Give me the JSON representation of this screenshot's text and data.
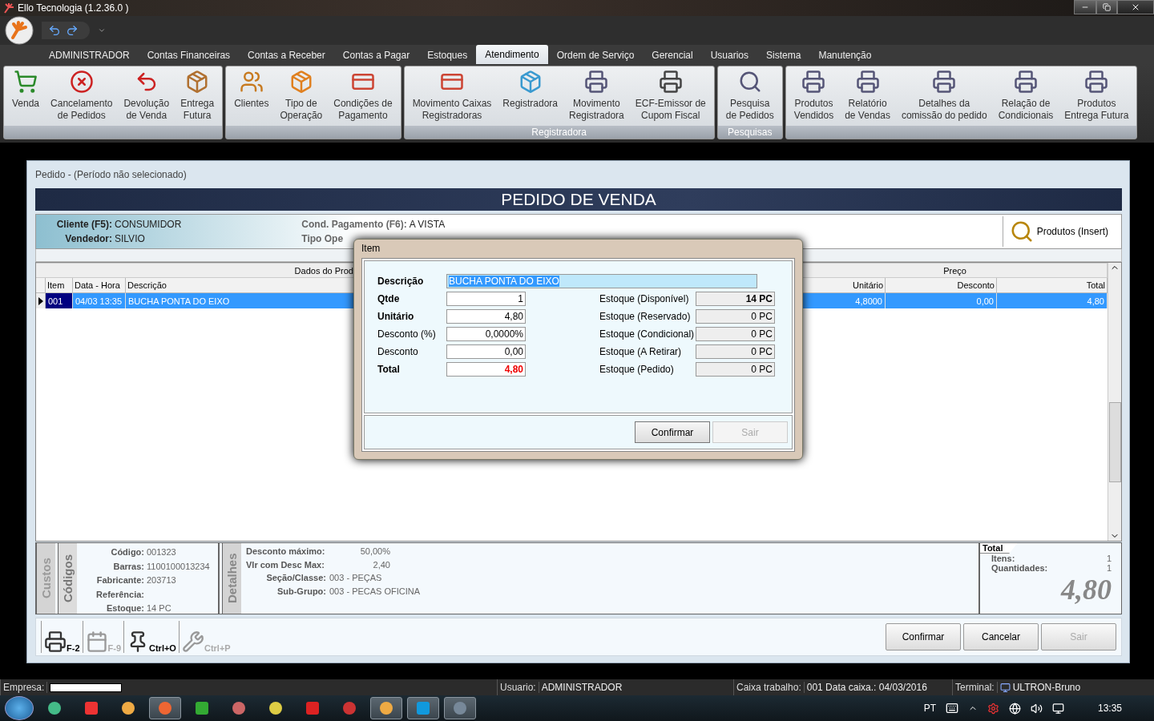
{
  "window": {
    "title": "Ello Tecnologia (1.2.36.0 )"
  },
  "menu_tabs": [
    {
      "label": "ADMINISTRADOR",
      "selected": false
    },
    {
      "label": "Contas Financeiras",
      "selected": false
    },
    {
      "label": "Contas a Receber",
      "selected": false
    },
    {
      "label": "Contas a Pagar",
      "selected": false
    },
    {
      "label": "Estoques",
      "selected": false
    },
    {
      "label": "Atendimento",
      "selected": true
    },
    {
      "label": "Ordem de Serviço",
      "selected": false
    },
    {
      "label": "Gerencial",
      "selected": false
    },
    {
      "label": "Usuarios",
      "selected": false
    },
    {
      "label": "Sistema",
      "selected": false
    },
    {
      "label": "Manutenção",
      "selected": false
    }
  ],
  "ribbon_groups": [
    {
      "items": [
        {
          "lines": [
            "Venda"
          ]
        },
        {
          "lines": [
            "Cancelamento",
            "de Pedidos"
          ]
        },
        {
          "lines": [
            "Devolução",
            "de Venda"
          ]
        },
        {
          "lines": [
            "Entrega",
            "Futura"
          ]
        }
      ]
    },
    {
      "items": [
        {
          "lines": [
            "Clientes"
          ]
        },
        {
          "lines": [
            "Tipo de",
            "Operação"
          ]
        },
        {
          "lines": [
            "Condições de",
            "Pagamento"
          ]
        }
      ]
    },
    {
      "caption": "Registradora",
      "items": [
        {
          "lines": [
            "Movimento Caixas",
            "Registradoras"
          ]
        },
        {
          "lines": [
            "Registradora"
          ]
        },
        {
          "lines": [
            "Movimento",
            "Registradora"
          ]
        },
        {
          "lines": [
            "ECF-Emissor de",
            "Cupom Fiscal"
          ]
        }
      ]
    },
    {
      "caption": "Pesquisas",
      "items": [
        {
          "lines": [
            "Pesquisa",
            "de Pedidos"
          ]
        }
      ]
    },
    {
      "items": [
        {
          "lines": [
            "Produtos",
            "Vendidos"
          ]
        },
        {
          "lines": [
            "Relatório",
            "de Vendas"
          ]
        },
        {
          "lines": [
            "Detalhes da",
            "comissão do pedido"
          ]
        },
        {
          "lines": [
            "Relação de",
            "Condicionais"
          ]
        },
        {
          "lines": [
            "Produtos",
            "Entrega Futura"
          ]
        }
      ]
    }
  ],
  "order_window": {
    "title": "Pedido - (Período não selecionado)",
    "heading": "PEDIDO DE VENDA",
    "info_left": [
      {
        "label": "Cliente (F5):",
        "value": "CONSUMIDOR"
      },
      {
        "label": "Vendedor:",
        "value": "SILVIO"
      }
    ],
    "info_right": [
      {
        "label": "Cond. Pagamento (F6):",
        "value": "A VISTA"
      },
      {
        "label": "Tipo Ope"
      }
    ],
    "products_button": "Produtos (Insert)",
    "grid": {
      "groups": [
        "Dados do Prod",
        "Preço"
      ],
      "columns": [
        "Item",
        "Data - Hora",
        "Descrição",
        "Unitário",
        "Desconto",
        "Total"
      ],
      "rows": [
        {
          "selected": true,
          "cells": [
            "001",
            "04/03 13:35",
            "BUCHA  PONTA DO EIXO",
            "4,8000",
            "0,00",
            "4,80"
          ]
        }
      ]
    },
    "side_tabs": [
      {
        "label": "Custos",
        "selected": false
      },
      {
        "label": "Códigos",
        "selected": true
      }
    ],
    "codes": [
      {
        "label": "Código:",
        "value": "001323"
      },
      {
        "label": "Barras:",
        "value": "1100100013234"
      },
      {
        "label": "Fabricante:",
        "value": "203713"
      },
      {
        "label": "Referência:"
      },
      {
        "label": "Estoque:",
        "value": "14 PC"
      }
    ],
    "details_tab": "Detalhes",
    "details": [
      {
        "label": "Desconto máximo:",
        "value": "50,00%",
        "kind": "pair"
      },
      {
        "label": "Vlr com Desc Max:",
        "value": "2,40",
        "kind": "pair"
      },
      {
        "label": "Seção/Classe:",
        "value": "003 - PEÇAS",
        "kind": "inline"
      },
      {
        "label": "Sub-Grupo:",
        "value": "003 - PECAS OFICINA",
        "kind": "inline"
      }
    ],
    "totals": {
      "title": "Total",
      "rows": [
        {
          "label": "Itens:",
          "value": "1"
        },
        {
          "label": "Quantidades:",
          "value": "1"
        }
      ],
      "amount": "4,80"
    },
    "shortcuts": [
      {
        "label": "F-2",
        "disabled": false
      },
      {
        "label": "F-9",
        "disabled": true
      },
      {
        "label": "Ctrl+O",
        "disabled": false
      },
      {
        "label": "Ctrl+P",
        "disabled": true
      }
    ],
    "actions": [
      {
        "label": "Confirmar",
        "disabled": false
      },
      {
        "label": "Cancelar",
        "disabled": false
      },
      {
        "label": "Sair",
        "disabled": true
      }
    ]
  },
  "item_dialog": {
    "title": "Item",
    "description": {
      "label": "Descrição",
      "value": "BUCHA  PONTA DO EIXO",
      "selected": true
    },
    "fields": [
      {
        "label": "Qtde",
        "value": "1",
        "bold": true,
        "highlight": false
      },
      {
        "label": "Unitário",
        "value": "4,80",
        "bold": true,
        "highlight": false
      },
      {
        "label": "Desconto (%)",
        "value": "0,0000%",
        "bold": false,
        "highlight": false
      },
      {
        "label": "Desconto",
        "value": "0,00",
        "bold": false,
        "highlight": false
      },
      {
        "label": "Total",
        "value": "4,80",
        "bold": true,
        "highlight": true
      }
    ],
    "stock": [
      {
        "label": "Estoque (Disponível)",
        "value": "14 PC",
        "bold": true
      },
      {
        "label": "Estoque (Reservado)",
        "value": "0 PC",
        "bold": false
      },
      {
        "label": "Estoque (Condicional)",
        "value": "0 PC",
        "bold": false
      },
      {
        "label": "Estoque (A Retirar)",
        "value": "0 PC",
        "bold": false
      },
      {
        "label": "Estoque (Pedido)",
        "value": "0 PC",
        "bold": false
      }
    ],
    "buttons": [
      {
        "label": "Confirmar",
        "disabled": false
      },
      {
        "label": "Sair",
        "disabled": true
      }
    ]
  },
  "status_bar": {
    "company_label": "Empresa:",
    "fields": [
      {
        "label": "Usuario:",
        "value": "ADMINISTRADOR"
      },
      {
        "label": "Caixa trabalho:",
        "value": "001  Data caixa.: 04/03/2016"
      },
      {
        "label": "Terminal:",
        "value": "ULTRON-Bruno"
      }
    ]
  },
  "taskbar": {
    "apps": [
      {
        "running": false
      },
      {
        "running": false
      },
      {
        "running": false
      },
      {
        "running": true
      },
      {
        "running": false
      },
      {
        "running": false
      },
      {
        "running": false
      },
      {
        "running": false
      },
      {
        "running": false
      },
      {
        "running": true
      },
      {
        "running": true
      },
      {
        "running": true
      }
    ],
    "language": "PT",
    "clock": "13:35"
  }
}
